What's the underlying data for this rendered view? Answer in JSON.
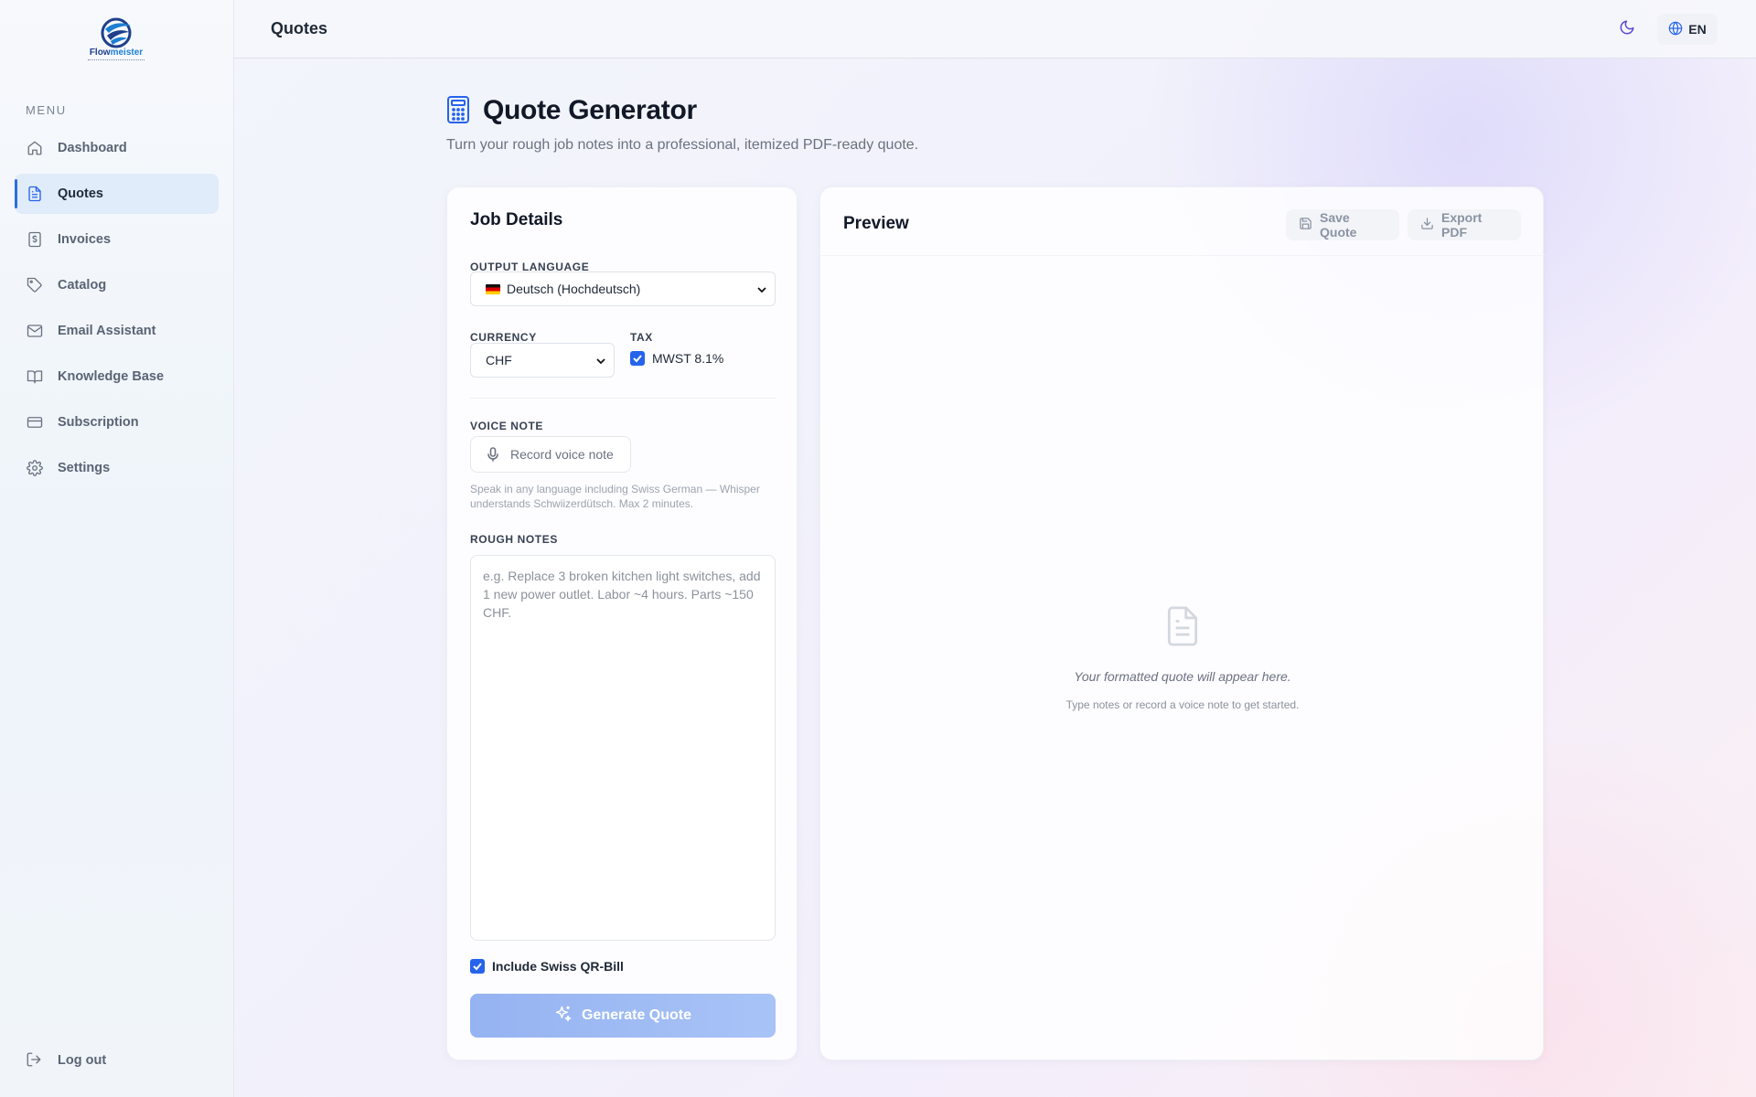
{
  "app": {
    "logo_name_a": "Flow",
    "logo_name_b": "meister"
  },
  "sidebar": {
    "menu_label": "MENU",
    "items": [
      {
        "label": "Dashboard",
        "icon": "home-icon"
      },
      {
        "label": "Quotes",
        "icon": "document-icon",
        "active": true
      },
      {
        "label": "Invoices",
        "icon": "dollar-file-icon"
      },
      {
        "label": "Catalog",
        "icon": "tag-icon"
      },
      {
        "label": "Email Assistant",
        "icon": "mail-icon"
      },
      {
        "label": "Knowledge Base",
        "icon": "book-icon"
      },
      {
        "label": "Subscription",
        "icon": "credit-card-icon"
      },
      {
        "label": "Settings",
        "icon": "gear-icon"
      }
    ],
    "logout_label": "Log out"
  },
  "header": {
    "title": "Quotes",
    "language": "EN"
  },
  "page": {
    "title": "Quote Generator",
    "subtitle": "Turn your rough job notes into a professional, itemized PDF-ready quote."
  },
  "job_details": {
    "title": "Job Details",
    "output_language_label": "OUTPUT LANGUAGE",
    "output_language_value": "Deutsch (Hochdeutsch)",
    "currency_label": "CURRENCY",
    "currency_value": "CHF",
    "tax_label": "TAX",
    "tax_option": "MWST 8.1%",
    "tax_checked": true,
    "voice_label": "VOICE NOTE",
    "voice_button": "Record voice note",
    "voice_hint": "Speak in any language including Swiss German — Whisper understands Schwiizerdütsch. Max 2 minutes.",
    "notes_label": "ROUGH NOTES",
    "notes_placeholder": "e.g. Replace 3 broken kitchen light switches, add 1 new power outlet. Labor ~4 hours. Parts ~150 CHF.",
    "qr_label": "Include Swiss QR-Bill",
    "qr_checked": true,
    "generate_button": "Generate Quote"
  },
  "preview": {
    "title": "Preview",
    "save_button": "Save Quote",
    "export_button": "Export PDF",
    "empty_main": "Your formatted quote will appear here.",
    "empty_sub": "Type notes or record a voice note to get started."
  },
  "colors": {
    "accent": "#2563eb",
    "active_nav_bg": "#e1ecfa",
    "generate_button": "#9bb8f3",
    "theme_icon": "#5b4ad6"
  }
}
